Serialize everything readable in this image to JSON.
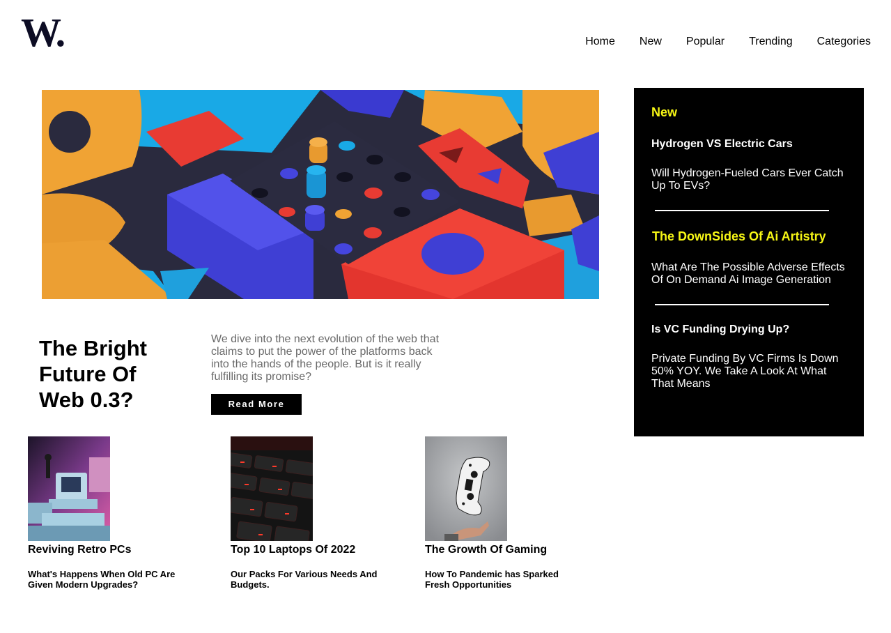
{
  "brand": {
    "logo_text": "W."
  },
  "nav": {
    "items": [
      {
        "label": "Home"
      },
      {
        "label": "New"
      },
      {
        "label": "Popular"
      },
      {
        "label": "Trending"
      },
      {
        "label": "Categories"
      }
    ]
  },
  "hero": {
    "title": "The Bright Future Of Web 0.3?",
    "description": "We dive into the next evolution of the web that claims to put the power of the platforms back into the hands of the people. But is it really fulfilling its promise?",
    "button_label": "Read More"
  },
  "sidebar": {
    "heading": "New",
    "articles": [
      {
        "title": "Hydrogen VS Electric Cars",
        "description": "Will Hydrogen-Fueled Cars Ever Catch Up To EVs?"
      },
      {
        "title": "The DownSides Of Ai Artistry",
        "description": "What Are The Possible Adverse Effects Of On Demand Ai Image Generation"
      },
      {
        "title": "Is VC Funding Drying Up?",
        "description": "Private Funding By VC Firms Is Down 50% YOY. We Take A Look At What That Means"
      }
    ]
  },
  "cards": [
    {
      "title": "Reviving Retro PCs",
      "description": "What's Happens When Old PC Are Given Modern Upgrades?"
    },
    {
      "title": "Top 10 Laptops Of 2022",
      "description": "Our Packs For Various Needs And Budgets."
    },
    {
      "title": "The Growth Of Gaming",
      "description": "How To Pandemic has Sparked Fresh Opportunities"
    }
  ],
  "colors": {
    "accent_yellow": "#f6f615",
    "sidebar_bg": "#000000",
    "button_bg": "#000000",
    "desc_gray": "#6a6a6a"
  }
}
